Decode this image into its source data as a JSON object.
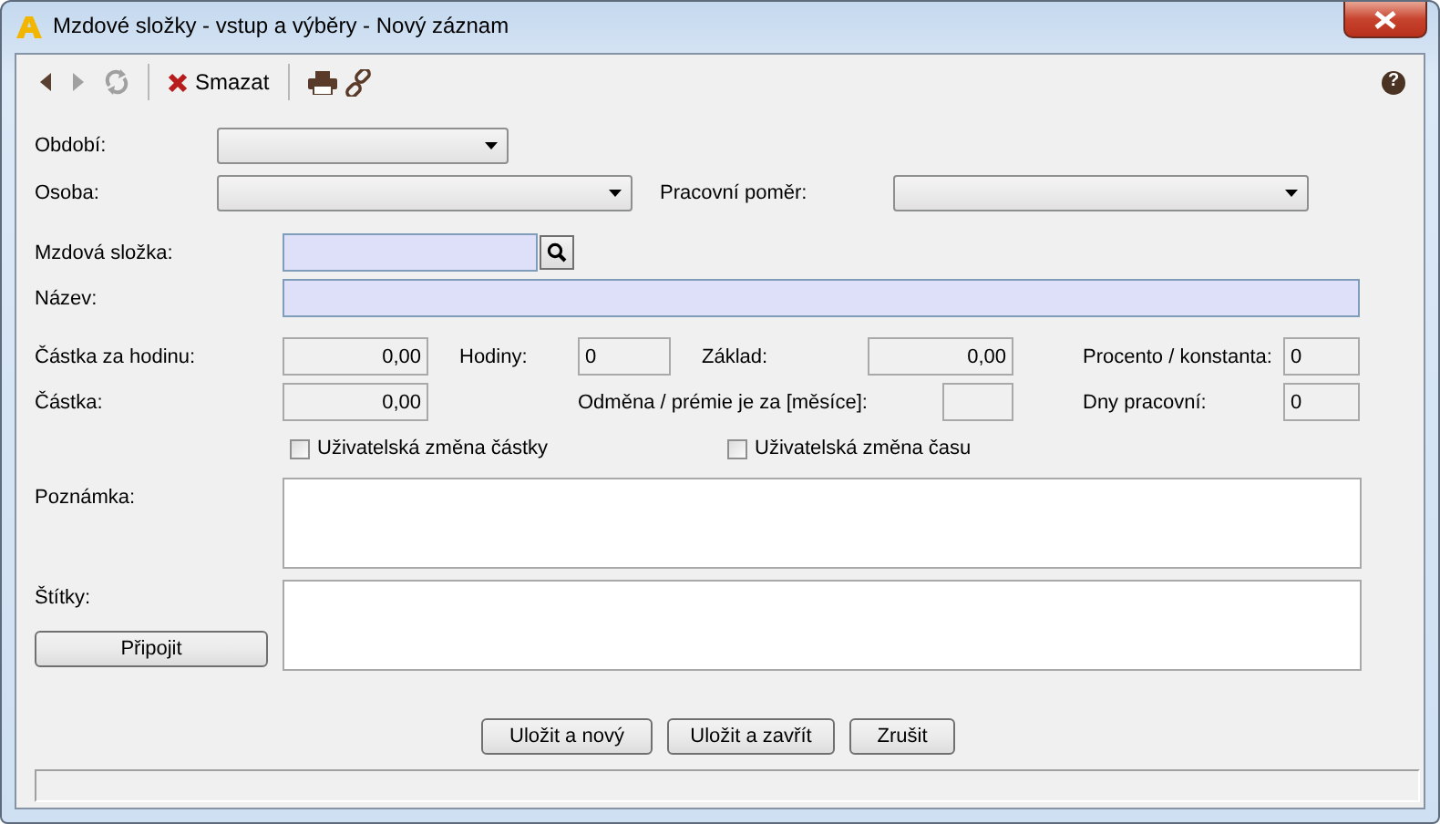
{
  "window": {
    "title": "Mzdové složky - vstup a výběry - Nový záznam"
  },
  "toolbar": {
    "nav": [
      {
        "kind": "back",
        "disabled": false
      },
      {
        "kind": "forward",
        "disabled": true
      },
      {
        "kind": "refresh",
        "disabled": true
      }
    ],
    "delete_label": "Smazat",
    "help": "?"
  },
  "period": {
    "label": "Období:"
  },
  "person": {
    "label": "Osoba:"
  },
  "employment": {
    "label": "Pracovní poměr:"
  },
  "component": {
    "label": "Mzdová složka:",
    "required": true
  },
  "name": {
    "label": "Název:",
    "required": true
  },
  "amount_rows": [
    [
      {
        "label": "Částka za hodinu:",
        "value": "0,00",
        "kind": "amount"
      },
      {
        "label": "Hodiny:",
        "value": "0",
        "kind": "count"
      },
      {
        "label": "Základ:",
        "value": "0,00",
        "kind": "amount"
      },
      {
        "label": "Procento / konstanta:",
        "value": "0",
        "kind": "count"
      }
    ],
    [
      {
        "label": "Částka:",
        "value": "0,00",
        "kind": "amount"
      },
      {
        "label": "Odměna / prémie je za [měsíce]:",
        "kind": "count"
      },
      {
        "label": "Dny pracovní:",
        "value": "0",
        "kind": "count"
      }
    ]
  ],
  "checkboxes": [
    {
      "label": "Uživatelská změna částky",
      "checked": false
    },
    {
      "label": "Uživatelská změna času",
      "checked": false
    }
  ],
  "note": {
    "label": "Poznámka:"
  },
  "tags": {
    "label": "Štítky:",
    "attach_button": "Připojit"
  },
  "buttons": [
    "Uložit a nový",
    "Uložit a zavřít",
    "Zrušit"
  ]
}
